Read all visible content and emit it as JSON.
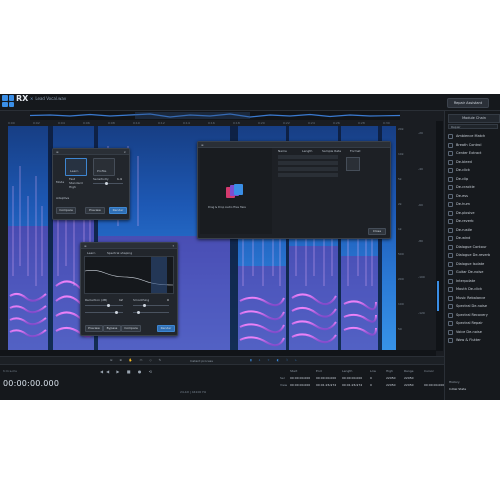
{
  "app": {
    "name": "RX",
    "file_tab": "Lead Vocal.wav",
    "repair_button": "Repair Assistant"
  },
  "ruler_ticks": [
    "0:00",
    "0:02",
    "0:04",
    "0:06",
    "0:08",
    "0:10",
    "0:12",
    "0:14",
    "0:16",
    "0:18",
    "0:20",
    "0:22",
    "0:24",
    "0:26",
    "0:28",
    "0:30"
  ],
  "freq_ticks": [
    "20k",
    "10k",
    "5k",
    "2k",
    "1k",
    "500",
    "200",
    "100",
    "50"
  ],
  "db_ticks": [
    "-20",
    "-40",
    "-60",
    "-80",
    "-100",
    "-120"
  ],
  "module_panel": {
    "chain_label": "Module Chain",
    "filter": "Repair",
    "modules": [
      "Ambience Match",
      "Breath Control",
      "Center Extract",
      "De-bleed",
      "De-click",
      "De-clip",
      "De-crackle",
      "De-ess",
      "De-hum",
      "De-plosive",
      "De-reverb",
      "De-rustle",
      "De-wind",
      "Dialogue Contour",
      "Dialogue De-reverb",
      "Dialogue Isolate",
      "Guitar De-noise",
      "Interpolate",
      "Mouth De-click",
      "Music Rebalance",
      "Spectral De-noise",
      "Spectral Recovery",
      "Spectral Repair",
      "Voice De-noise",
      "Wow & Flutter"
    ]
  },
  "history": {
    "title": "History",
    "item": "Initial State"
  },
  "transport": {
    "label": "Instant process",
    "timecode": "00:00:00.000",
    "format_label": "h:m:s.ms",
    "bit_info": "24-bit | 44100 Hz",
    "columns": [
      "Start",
      "End",
      "Length",
      "Low",
      "High",
      "Range",
      "Cursor"
    ],
    "sel_row_label": "Sel",
    "view_row_label": "View",
    "sel_values": [
      "00:00:00.000",
      "00:00:00.000",
      "00:00:00.000",
      "0",
      "22050",
      "22050",
      ""
    ],
    "view_values": [
      "00:00:00.000",
      "00:01:26.974",
      "00:01:26.974",
      "0",
      "22050",
      "22050",
      "00:00:00.000"
    ]
  },
  "dialog_denoise": {
    "mode_label": "Mode",
    "adaptive_label": "Adaptive",
    "options": [
      "Fast",
      "Standard",
      "High"
    ],
    "sensitivity_label": "Sensitivity",
    "sensitivity_value": "1.4",
    "noise_label": "Noise",
    "profile_label": "Profile",
    "compare": "Compare",
    "preview": "Preview",
    "render": "Render",
    "learn": "Learn"
  },
  "dialog_eq": {
    "tab1": "Learn",
    "tab2": "Spectral shaping",
    "reduction_label": "Reduction (dB)",
    "reduction_value": "12",
    "smoothing_label": "Smoothing",
    "smoothing_value": "0",
    "buttons": [
      "Preview",
      "Bypass",
      "Compare",
      "Render"
    ]
  },
  "dialog_import": {
    "drop_text": "Drag & Drop Audio Files Here",
    "columns": [
      "Name",
      "Length",
      "Sample Rate",
      "Format"
    ],
    "close": "Close"
  }
}
